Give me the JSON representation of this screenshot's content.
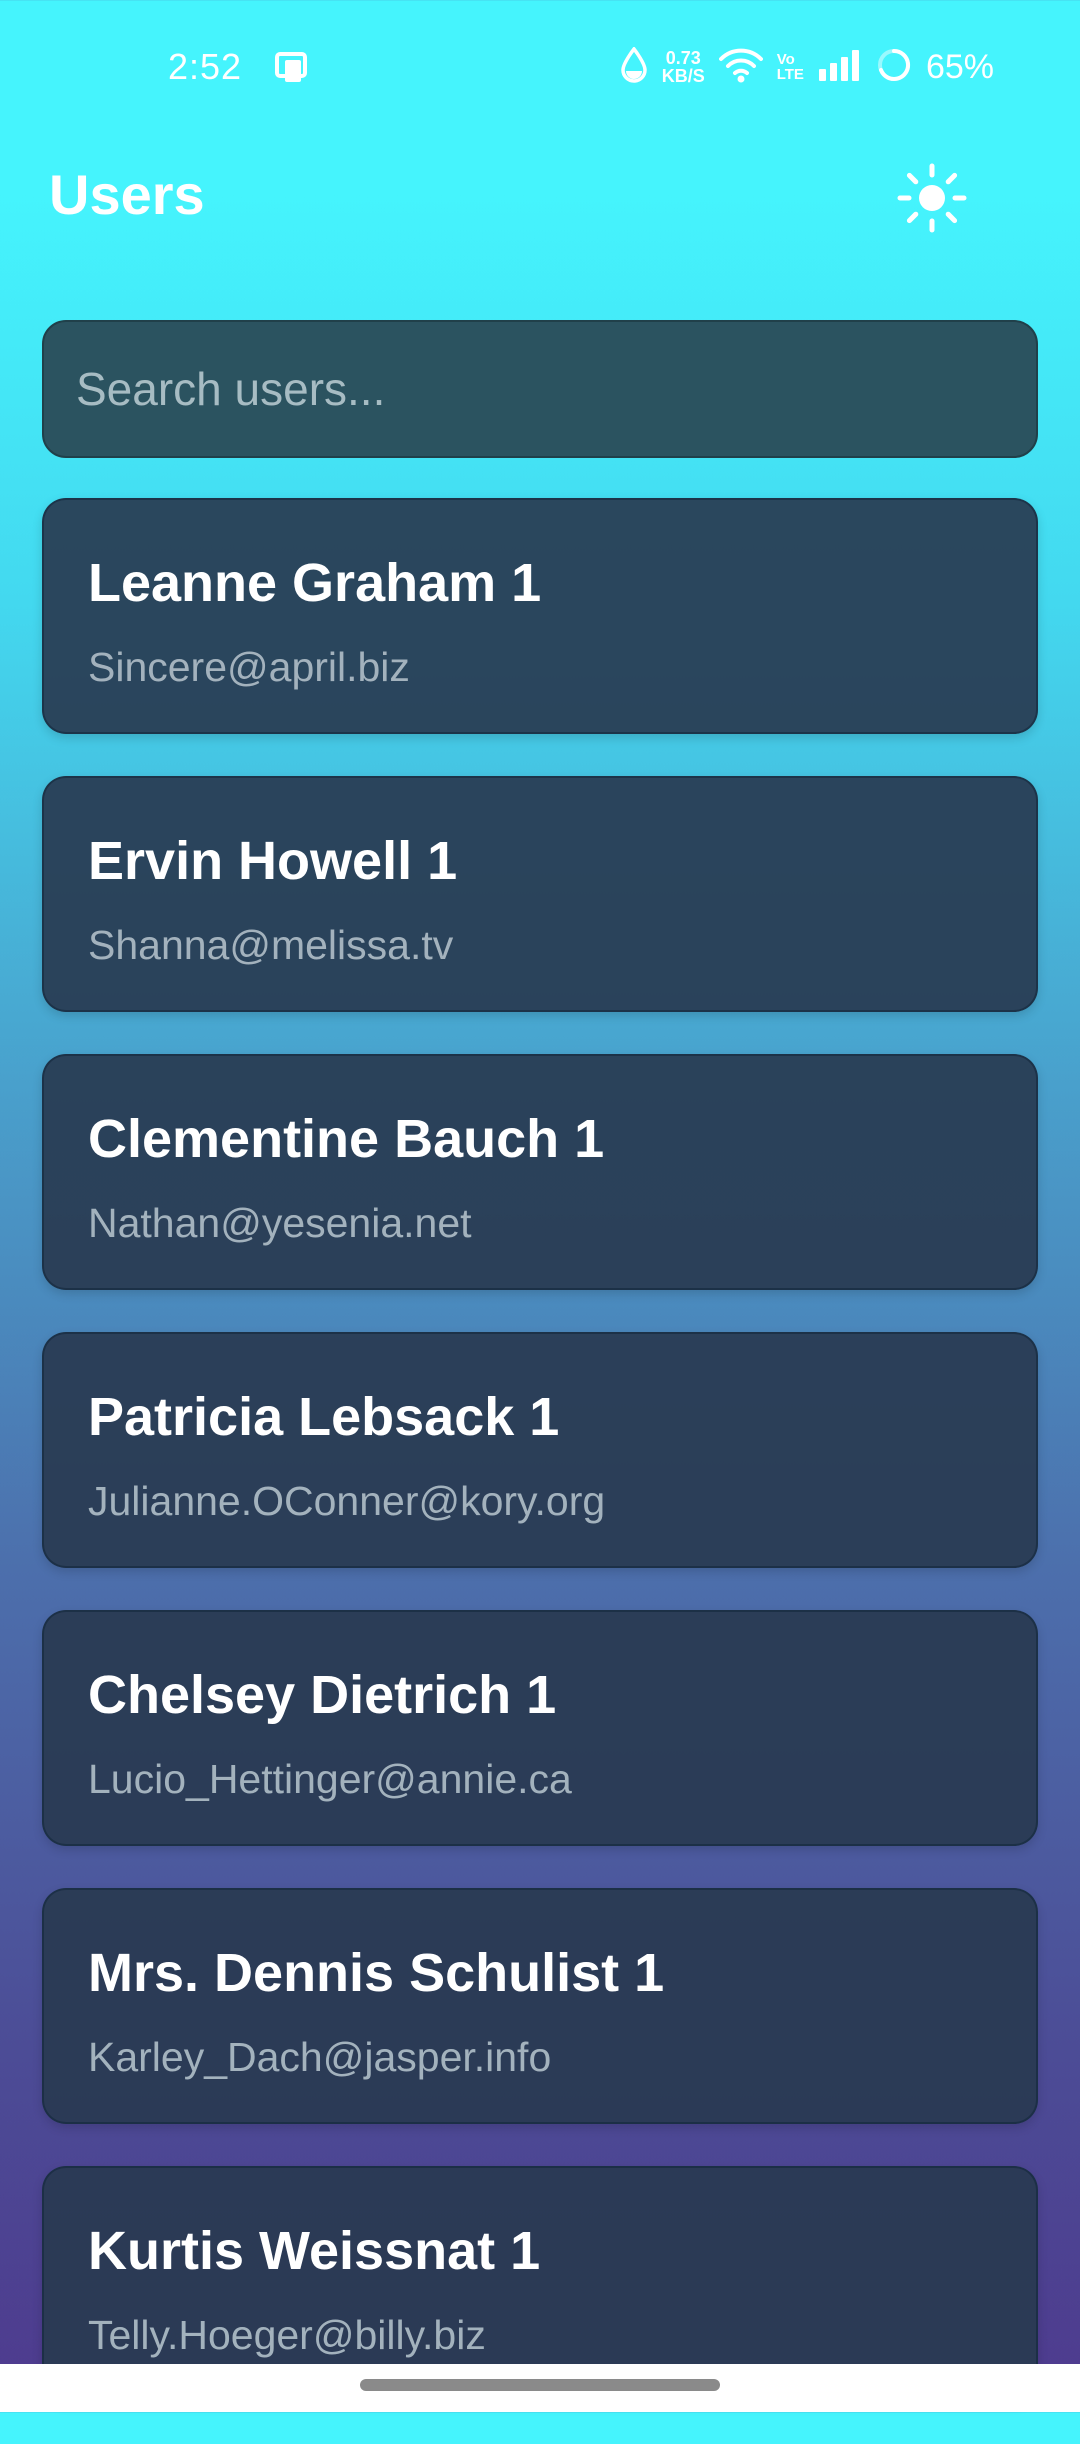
{
  "status_bar": {
    "time": "2:52",
    "net_speed_value": "0.73",
    "net_speed_unit": "KB/S",
    "volte_top": "Vo",
    "volte_bottom": "LTE",
    "battery": "65%"
  },
  "header": {
    "title": "Users",
    "theme_icon": "sun-icon"
  },
  "search": {
    "placeholder": "Search users...",
    "value": ""
  },
  "users": [
    {
      "name": "Leanne Graham 1",
      "email": "Sincere@april.biz"
    },
    {
      "name": "Ervin Howell 1",
      "email": "Shanna@melissa.tv"
    },
    {
      "name": "Clementine Bauch 1",
      "email": "Nathan@yesenia.net"
    },
    {
      "name": "Patricia Lebsack 1",
      "email": "Julianne.OConner@kory.org"
    },
    {
      "name": "Chelsey Dietrich 1",
      "email": "Lucio_Hettinger@annie.ca"
    },
    {
      "name": "Mrs. Dennis Schulist 1",
      "email": "Karley_Dach@jasper.info"
    },
    {
      "name": "Kurtis Weissnat 1",
      "email": "Telly.Hoeger@billy.biz"
    }
  ],
  "colors": {
    "gradient_top": "#45f4fd",
    "gradient_bottom": "#4e3a8e",
    "card": "#283a50",
    "search_bg": "#2b5360"
  }
}
